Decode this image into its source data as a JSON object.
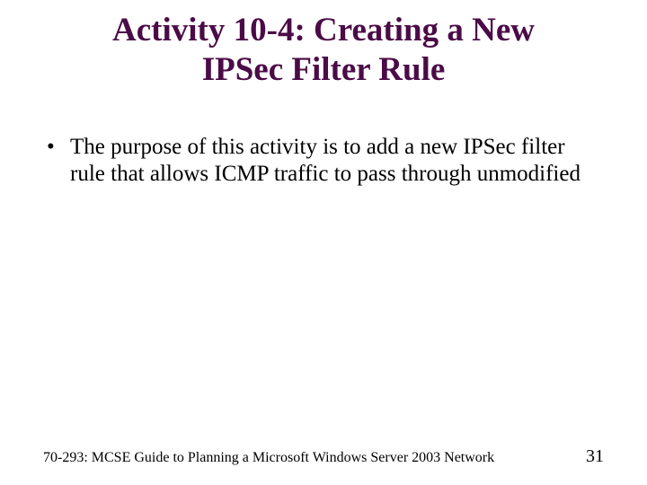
{
  "title_line1": "Activity 10-4: Creating a New",
  "title_line2": "IPSec Filter Rule",
  "bullet_symbol": "•",
  "bullet1": "The purpose of this activity is to add a new IPSec filter rule that allows ICMP traffic to pass through unmodified",
  "footer_left": "70-293: MCSE Guide to Planning a Microsoft Windows Server 2003 Network",
  "footer_right": "31"
}
